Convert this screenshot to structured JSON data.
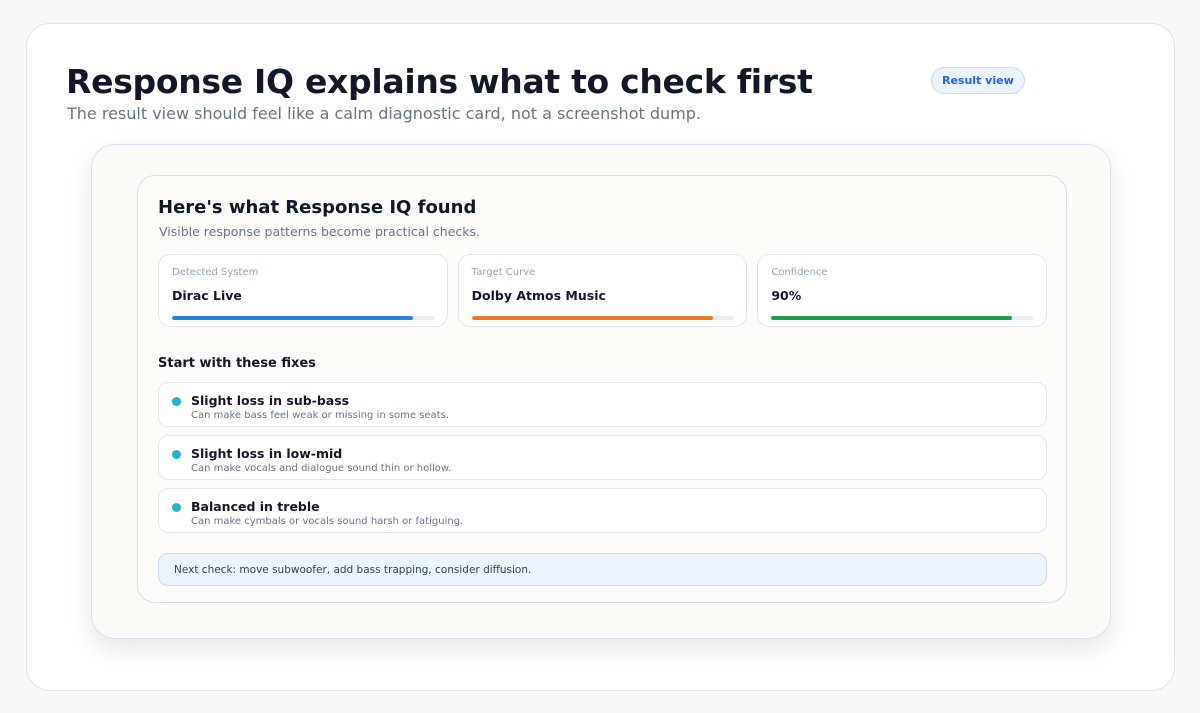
{
  "header": {
    "title": "Response IQ explains what to check first",
    "subtitle": "The result view should feel like a calm diagnostic card, not a screenshot dump.",
    "badge": "Result view"
  },
  "card": {
    "title": "Here's what Response IQ found",
    "subtitle": "Visible response patterns become practical checks.",
    "metrics": [
      {
        "label": "Detected System",
        "value": "Dirac Live",
        "progress": 0.92,
        "color": "#2383e2"
      },
      {
        "label": "Target Curve",
        "value": "Dolby Atmos Music",
        "progress": 0.92,
        "color": "#f07a22"
      },
      {
        "label": "Confidence",
        "value": "90%",
        "progress": 0.92,
        "color": "#16a34a"
      }
    ],
    "fixes_title": "Start with these fixes",
    "fixes": [
      {
        "title": "Slight loss in sub-bass",
        "description": "Can make bass feel weak or missing in some seats."
      },
      {
        "title": "Slight loss in low-mid",
        "description": "Can make vocals and dialogue sound thin or hollow."
      },
      {
        "title": "Balanced in treble",
        "description": "Can make cymbals or vocals sound harsh or fatiguing."
      }
    ],
    "next_check": "Next check: move subwoofer, add bass trapping, consider diffusion."
  },
  "colors": {
    "accent": "#2563eb",
    "fix_dot": "#1fb3cf"
  },
  "icons": {
    "fix_indicator": "status-dot-icon"
  }
}
